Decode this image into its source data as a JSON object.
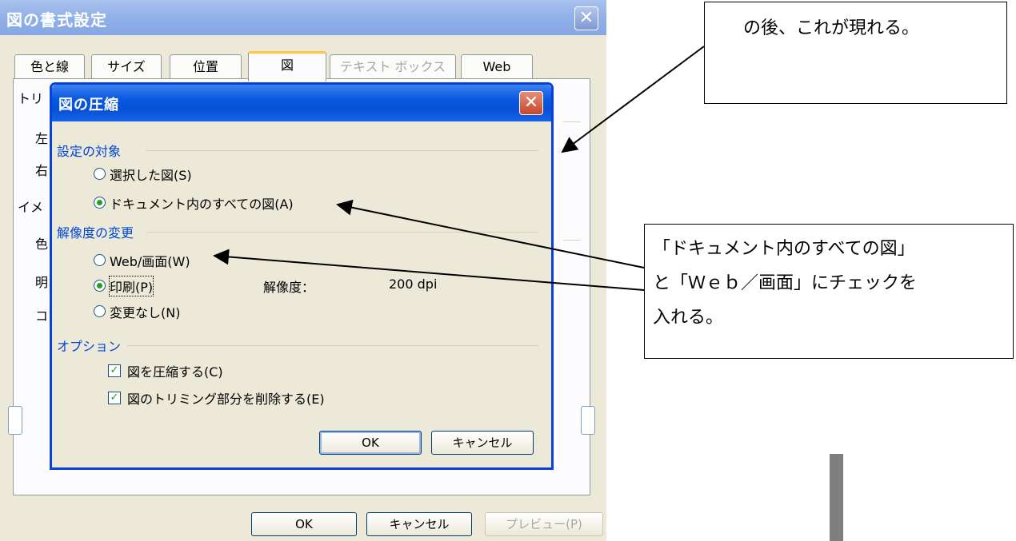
{
  "outer_dialog": {
    "title": "図の書式設定",
    "close": "✕",
    "tabs": [
      {
        "label": "色と線"
      },
      {
        "label": "サイズ"
      },
      {
        "label": "位置"
      },
      {
        "label": "図"
      },
      {
        "label": "テキスト ボックス"
      },
      {
        "label": "Web"
      }
    ],
    "peek_labels": [
      "トリ",
      "左",
      "右",
      "イメ",
      "色",
      "明",
      "コ"
    ],
    "buttons": {
      "ok": "OK",
      "cancel": "キャンセル",
      "preview": "プレビュー(P)"
    }
  },
  "inner_dialog": {
    "title": "図の圧縮",
    "close": "✕",
    "target_group": {
      "label": "設定の対象",
      "options": [
        {
          "label": "選択した図(S)",
          "selected": false
        },
        {
          "label": "ドキュメント内のすべての図(A)",
          "selected": true
        }
      ]
    },
    "resolution_group": {
      "label": "解像度の変更",
      "options": [
        {
          "label": "Web/画面(W)",
          "selected": false
        },
        {
          "label": "印刷(P)",
          "selected": true
        },
        {
          "label": "変更なし(N)",
          "selected": false
        }
      ],
      "resolution_label": "解像度：",
      "resolution_value": "200 dpi"
    },
    "options_group": {
      "label": "オプション",
      "checks": [
        {
          "label": "図を圧縮する(C)",
          "checked": true
        },
        {
          "label": "図のトリミング部分を削除する(E)",
          "checked": true
        }
      ]
    },
    "buttons": {
      "ok": "OK",
      "cancel": "キャンセル"
    }
  },
  "callouts": {
    "top": "の後、これが現れる。",
    "middle_line1": "「ドキュメント内のすべての図」",
    "middle_line2": "と「Ｗｅｂ／画面」にチェックを",
    "middle_line3": "入れる。"
  },
  "colors": {
    "accent": "#0851d6",
    "check": "#21a121",
    "group_label": "#0046d5"
  }
}
